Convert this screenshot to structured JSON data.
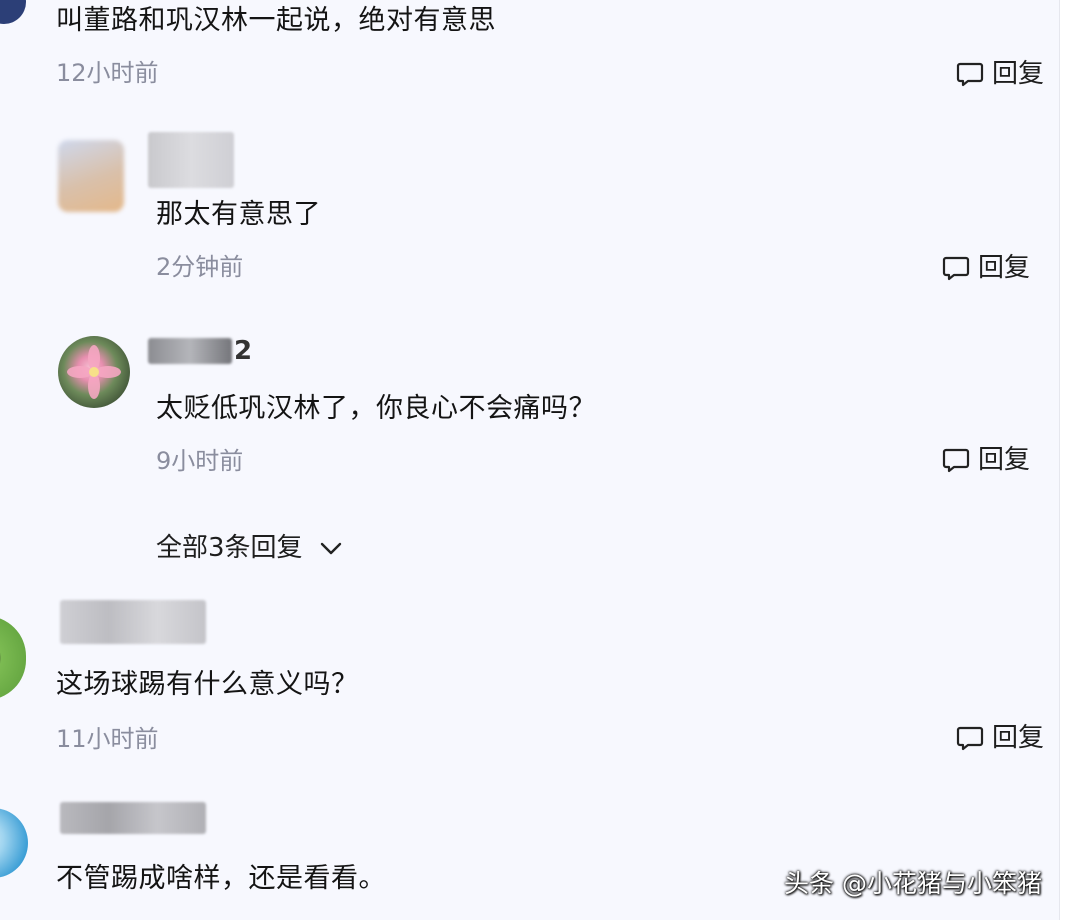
{
  "comments": [
    {
      "text": "叫董路和巩汉林一起说，绝对有意思",
      "time": "12小时前",
      "reply_label": "回复"
    },
    {
      "text": "那太有意思了",
      "time": "2分钟前",
      "reply_label": "回复"
    },
    {
      "username_visible_char": "2",
      "text": "太贬低巩汉林了，你良心不会痛吗？",
      "time": "9小时前",
      "reply_label": "回复",
      "all_replies_label": "全部3条回复"
    },
    {
      "text": "这场球踢有什么意义吗？",
      "time": "11小时前",
      "reply_label": "回复"
    },
    {
      "text": "不管踢成啥样，还是看看。"
    }
  ],
  "watermark": "头条 @小花猪与小笨猪",
  "icons": {
    "reply": "comment-bubble-icon",
    "expand": "chevron-down-icon"
  },
  "colors": {
    "background": "#f7f8fe",
    "text": "#141414",
    "muted": "#8a8d9e"
  }
}
